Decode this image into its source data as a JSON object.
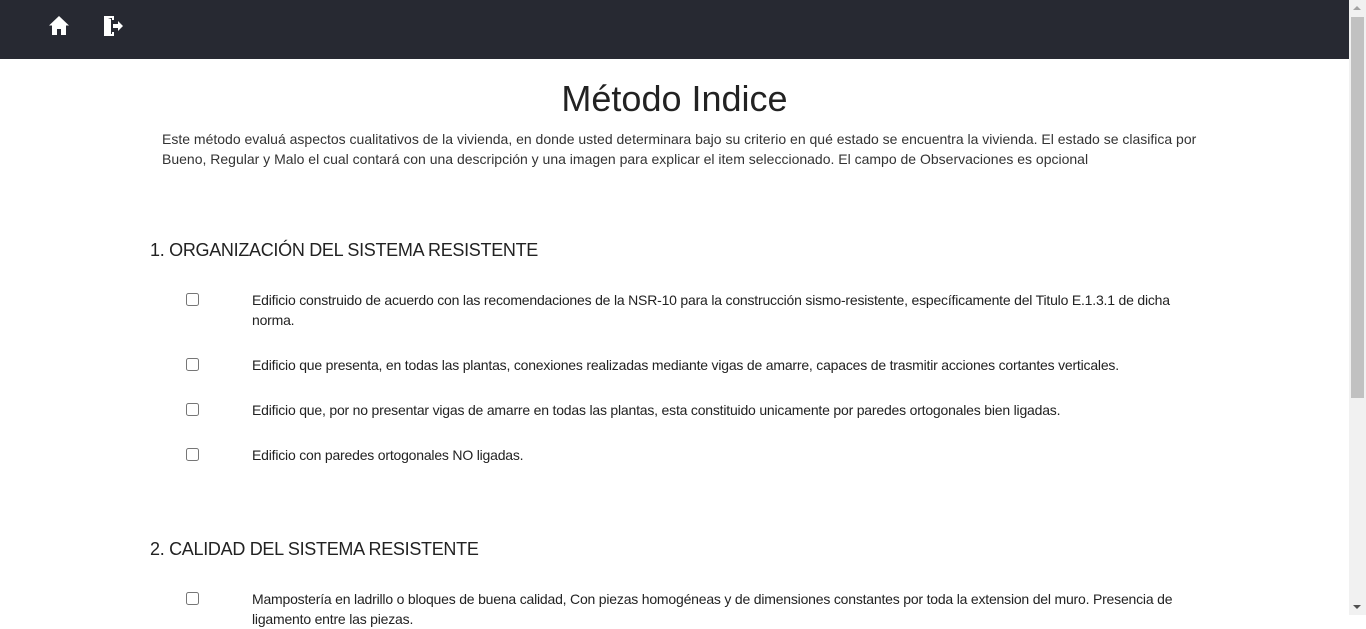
{
  "nav": {
    "home_icon": "home-icon",
    "logout_icon": "logout-icon"
  },
  "page": {
    "title": "Método Indice",
    "intro": "Este método evaluá aspectos cualitativos de la vivienda,  en donde usted determinara bajo su criterio en qué estado  se encuentra la vivienda. El estado se clasifica por Bueno, Regular y Malo el cual contará con una descripción y una imagen para explicar el item seleccionado. El campo de Observaciones es opcional"
  },
  "sections": [
    {
      "title": "1. ORGANIZACIÓN DEL SISTEMA RESISTENTE",
      "options": [
        "Edificio construido de acuerdo con las recomendaciones de la NSR-10 para la construcción sismo-resistente, específicamente del Titulo E.1.3.1 de dicha norma.",
        "Edificio que presenta, en todas las plantas, conexiones realizadas mediante vigas de amarre, capaces de trasmitir acciones cortantes verticales.",
        "Edificio que, por no presentar vigas de amarre en todas las plantas, esta constituido unicamente por paredes ortogonales bien ligadas.",
        "Edificio con paredes ortogonales NO ligadas."
      ]
    },
    {
      "title": "2. CALIDAD DEL SISTEMA RESISTENTE",
      "options": [
        "Mampostería en ladrillo o bloques de buena calidad, Con piezas homogéneas y de dimensiones constantes por toda la extension del muro. Presencia de ligamento entre las piezas."
      ]
    }
  ],
  "colors": {
    "topbar": "#272932",
    "background": "#ffffff",
    "text": "#222222"
  }
}
